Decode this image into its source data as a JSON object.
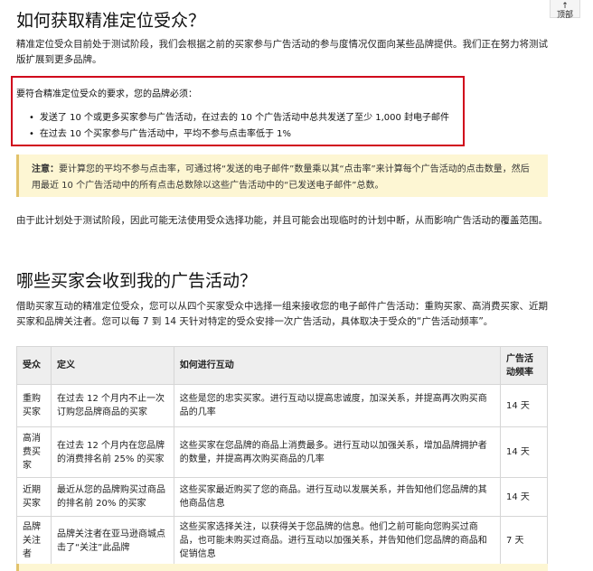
{
  "back_to_top": {
    "arrow": "↑",
    "label": "顶部"
  },
  "section1": {
    "heading": "如何获取精准定位受众？",
    "intro": "精准定位受众目前处于测试阶段，我们会根据之前的买家参与广告活动的参与度情况仅面向某些品牌提供。我们正在努力将测试版扩展到更多品牌。",
    "requirements_title": "要符合精准定位受众的要求，您的品牌必须：",
    "requirements": [
      "发送了 10 个或更多买家参与广告活动，在过去的 10 个广告活动中总共发送了至少 1,000 封电子邮件",
      "在过去 10 个买家参与广告活动中，平均不参与点击率低于 1%"
    ],
    "note_label": "注意：",
    "note_text": "要计算您的平均不参与点击率，可通过将“发送的电子邮件”数量乘以其“点击率”来计算每个广告活动的点击数量，然后用最近 10 个广告活动中的所有点击总数除以这些广告活动中的“已发送电子邮件”总数。",
    "limitation": "由于此计划处于测试阶段，因此可能无法使用受众选择功能，并且可能会出现临时的计划中断，从而影响广告活动的覆盖范围。"
  },
  "section2": {
    "heading": "哪些买家会收到我的广告活动？",
    "description": "借助买家互动的精准定位受众，您可以从四个买家受众中选择一组来接收您的电子邮件广告活动：重购买家、高消费买家、近期买家和品牌关注者。您可以每 7 到 14 天针对特定的受众安排一次广告活动，具体取决于受众的“广告活动频率”。",
    "table": {
      "headers": [
        "受众",
        "定义",
        "如何进行互动",
        "广告活动频率"
      ],
      "rows": [
        [
          "重购买家",
          "在过去 12 个月内不止一次订购您品牌商品的买家",
          "这些是您的忠实买家。进行互动以提高忠诚度，加深关系，并提高再次购买商品的几率",
          "14 天"
        ],
        [
          "高消费买家",
          "在过去 12 个月内在您品牌的消费排名前 25% 的买家",
          "这些买家在您品牌的商品上消费最多。进行互动以加强关系，增加品牌拥护者的数量，并提高再次购买商品的几率",
          "14 天"
        ],
        [
          "近期买家",
          "最近从您的品牌购买过商品的排名前 20% 的买家",
          "这些买家最近购买了您的商品。进行互动以发展关系，并告知他们您品牌的其他商品信息",
          "14 天"
        ],
        [
          "品牌关注者",
          "品牌关注者在亚马逊商城点击了“关注”此品牌",
          "这些买家选择关注，以获得关于您品牌的信息。他们之前可能向您购买过商品，也可能未购买过商品。进行互动以加强关系，并告知他们您品牌的商品和促销信息",
          "7 天"
        ]
      ]
    }
  }
}
